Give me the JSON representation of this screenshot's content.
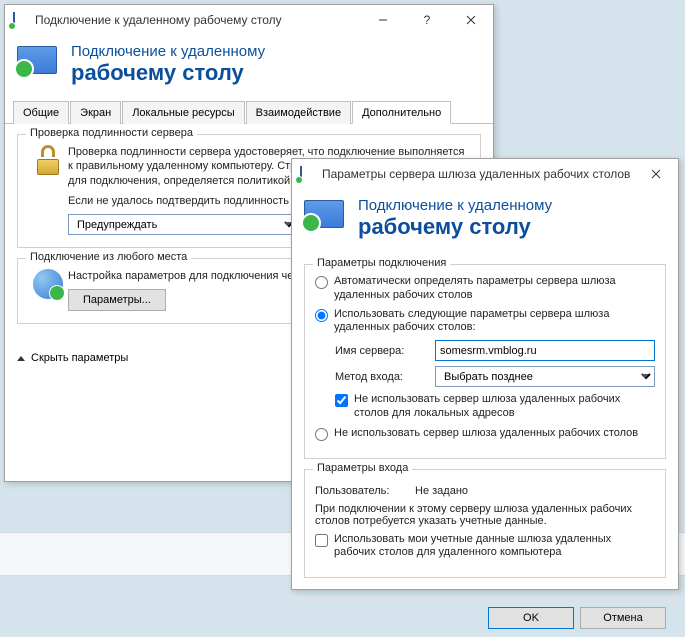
{
  "win1": {
    "title": "Подключение к удаленному рабочему столу",
    "header1": "Подключение к удаленному",
    "header2": "рабочему столу",
    "tabs": [
      "Общие",
      "Экран",
      "Локальные ресурсы",
      "Взаимодействие",
      "Дополнительно"
    ],
    "group_auth": {
      "title": "Проверка подлинности сервера",
      "p1": "Проверка подлинности сервера удостоверяет, что подключение выполняется к правильному удаленному компьютеру. Строгость проверки, необходимой для подключения, определяется политикой безопасности.",
      "p2": "Если не удалось подтвердить подлинность удаленного компьютера:",
      "select": "Предупреждать"
    },
    "group_anywhere": {
      "title": "Подключение из любого места",
      "p1": "Настройка параметров для подключения через шлюз при удаленной работе.",
      "btn": "Параметры..."
    },
    "hide": "Скрыть параметры"
  },
  "win2": {
    "title": "Параметры сервера шлюза удаленных рабочих столов",
    "header1": "Подключение к удаленному",
    "header2": "рабочему столу",
    "group_conn": {
      "title": "Параметры подключения",
      "opt_auto": "Автоматически определять параметры сервера шлюза удаленных рабочих столов",
      "opt_use": "Использовать следующие параметры сервера шлюза удаленных рабочих столов:",
      "server_label": "Имя сервера:",
      "server_value": "somesrm.vmblog.ru",
      "method_label": "Метод входа:",
      "method_value": "Выбрать позднее",
      "chk_local": "Не использовать сервер шлюза удаленных рабочих столов для локальных адресов",
      "opt_none": "Не использовать сервер шлюза удаленных рабочих столов"
    },
    "group_login": {
      "title": "Параметры входа",
      "user_label": "Пользователь:",
      "user_value": "Не задано",
      "note": "При подключении к этому серверу шлюза удаленных рабочих столов потребуется указать учетные данные.",
      "chk_cred": "Использовать мои учетные данные шлюза удаленных рабочих столов для удаленного компьютера"
    },
    "ok": "OK",
    "cancel": "Отмена"
  }
}
